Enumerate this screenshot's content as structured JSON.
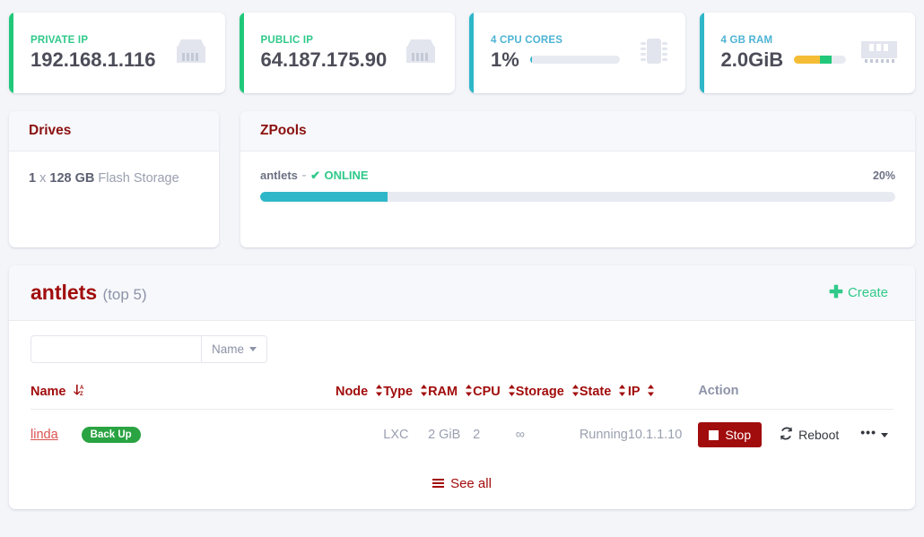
{
  "stats": [
    {
      "label": "PRIVATE IP",
      "value": "192.168.1.116",
      "accent": "#21c87a",
      "label_color": "#2fc98a",
      "icon": "ethernet-port-icon",
      "bar": null
    },
    {
      "label": "PUBLIC IP",
      "value": "64.187.175.90",
      "accent": "#21c87a",
      "label_color": "#2fc98a",
      "icon": "ethernet-port-icon",
      "bar": null
    },
    {
      "label": "4 CPU CORES",
      "value": "1%",
      "accent": "#2eb7c8",
      "label_color": "#4db3d4",
      "icon": "microchip-icon",
      "bar": {
        "segments": [
          {
            "pct": 2,
            "color": "#2eb7c8"
          }
        ],
        "track": "#e7eaf1"
      }
    },
    {
      "label": "4 GB RAM",
      "value": "2.0GiB",
      "accent": "#2eb7c8",
      "label_color": "#4db3d4",
      "icon": "memory-stick-icon",
      "bar": {
        "segments": [
          {
            "pct": 50,
            "color": "#f5bd35"
          },
          {
            "pct": 22,
            "color": "#21c87a"
          }
        ],
        "track": "#e7eaf1"
      }
    }
  ],
  "drives": {
    "title": "Drives",
    "count": "1",
    "separator": " x ",
    "size": "128 GB",
    "type": " Flash Storage"
  },
  "zpools": {
    "title": "ZPools",
    "pools": [
      {
        "name": "antlets",
        "dash": " - ",
        "check": "✔",
        "status": "ONLINE",
        "percent_label": "20%",
        "percent": 20,
        "bar_color": "#2eb7c8"
      }
    ]
  },
  "antlets": {
    "title": "antlets",
    "subtitle": "(top 5)",
    "create_label": "Create",
    "create_icon": "plus-icon",
    "filter": {
      "value": "",
      "placeholder": "",
      "select_label": "Name",
      "caret_icon": "chevron-down-icon"
    },
    "columns": [
      {
        "label": "Name",
        "sort_icon": "sort-alpha-down-icon",
        "sort": "↓",
        "alpha": "A\nZ"
      },
      {
        "label": "Node",
        "sort_icon": "sort-icon",
        "sort": "⬍"
      },
      {
        "label": "Type",
        "sort_icon": "sort-icon",
        "sort": "⬍"
      },
      {
        "label": "RAM",
        "sort_icon": "sort-icon",
        "sort": "⬍"
      },
      {
        "label": "CPU",
        "sort_icon": "sort-icon",
        "sort": "⬍"
      },
      {
        "label": "Storage",
        "sort_icon": "sort-icon",
        "sort": "⬍"
      },
      {
        "label": "State",
        "sort_icon": "sort-icon",
        "sort": "⬍"
      },
      {
        "label": "IP",
        "sort_icon": "sort-icon",
        "sort": "⬍"
      },
      {
        "label": "Action",
        "sort_icon": null
      }
    ],
    "rows": [
      {
        "name": "linda",
        "badge": "Back Up",
        "node": "",
        "type": "LXC",
        "ram": "2 GiB",
        "cpu": "2",
        "storage": "∞",
        "state": "Running",
        "ip": "10.1.1.10",
        "actions": {
          "stop_label": "Stop",
          "stop_icon": "stop-square-icon",
          "reboot_label": "Reboot",
          "reboot_icon": "refresh-icon",
          "more_icon": "ellipsis-icon"
        }
      }
    ],
    "see_all_label": "See all",
    "see_all_icon": "list-icon"
  }
}
